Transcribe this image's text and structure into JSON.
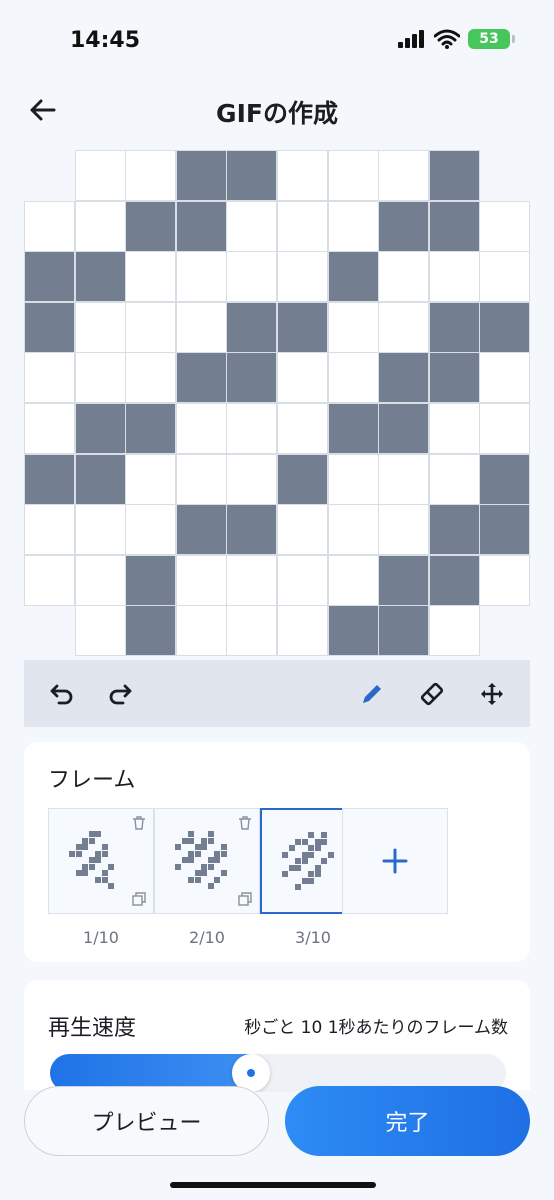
{
  "status_bar": {
    "time": "14:45",
    "battery": "53"
  },
  "header": {
    "title": "GIFの作成"
  },
  "canvas": {
    "on_color": "#737f90",
    "off_color": "#ffffff",
    "columns": 10,
    "rows": 10,
    "grid": [
      [
        null,
        0,
        0,
        1,
        1,
        0,
        0,
        0,
        1,
        null
      ],
      [
        0,
        0,
        1,
        1,
        0,
        0,
        0,
        1,
        1,
        0
      ],
      [
        1,
        1,
        0,
        0,
        0,
        0,
        1,
        0,
        0,
        0
      ],
      [
        1,
        0,
        0,
        0,
        1,
        1,
        0,
        0,
        1,
        1
      ],
      [
        0,
        0,
        0,
        1,
        1,
        0,
        0,
        1,
        1,
        0
      ],
      [
        0,
        1,
        1,
        0,
        0,
        0,
        1,
        1,
        0,
        0
      ],
      [
        1,
        1,
        0,
        0,
        0,
        1,
        0,
        0,
        0,
        1
      ],
      [
        0,
        0,
        0,
        1,
        1,
        0,
        0,
        0,
        1,
        1
      ],
      [
        0,
        0,
        1,
        0,
        0,
        0,
        0,
        1,
        1,
        0
      ],
      [
        null,
        0,
        1,
        0,
        0,
        0,
        1,
        1,
        0,
        null
      ]
    ]
  },
  "toolbar": {
    "tools": [
      {
        "name": "undo-icon",
        "active": false
      },
      {
        "name": "redo-icon",
        "active": false
      },
      {
        "name": "pencil-icon",
        "active": true
      },
      {
        "name": "eraser-icon",
        "active": false
      },
      {
        "name": "move-icon",
        "active": false
      }
    ],
    "accent": "#2a69c9",
    "default": "#1a1d24"
  },
  "frames": {
    "title": "フレーム",
    "items": [
      {
        "label": "1/10",
        "selected": false
      },
      {
        "label": "2/10",
        "selected": false
      },
      {
        "label": "3/10",
        "selected": true
      }
    ],
    "add_icon": "plus-icon"
  },
  "speed": {
    "title": "再生速度",
    "value_text": "秒ごと 10 1秒あたりのフレーム数",
    "fraction": 0.4
  },
  "actions": {
    "preview": "プレビュー",
    "done": "完了"
  }
}
